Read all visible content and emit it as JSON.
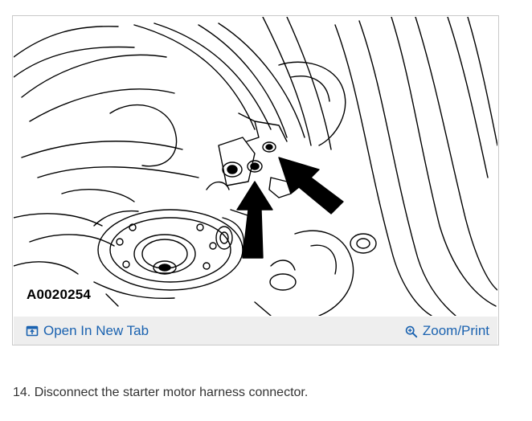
{
  "figure": {
    "image_code": "A0020254",
    "open_tab_label": "Open In New Tab",
    "zoom_print_label": "Zoom/Print",
    "open_icon": "open-in-new-tab-icon",
    "zoom_icon": "zoom-in-icon"
  },
  "step": {
    "text": "14. Disconnect the starter motor harness connector."
  },
  "colors": {
    "link": "#1a62b0",
    "toolbar_bg": "#eeeeee",
    "border": "#c9c9c9"
  }
}
